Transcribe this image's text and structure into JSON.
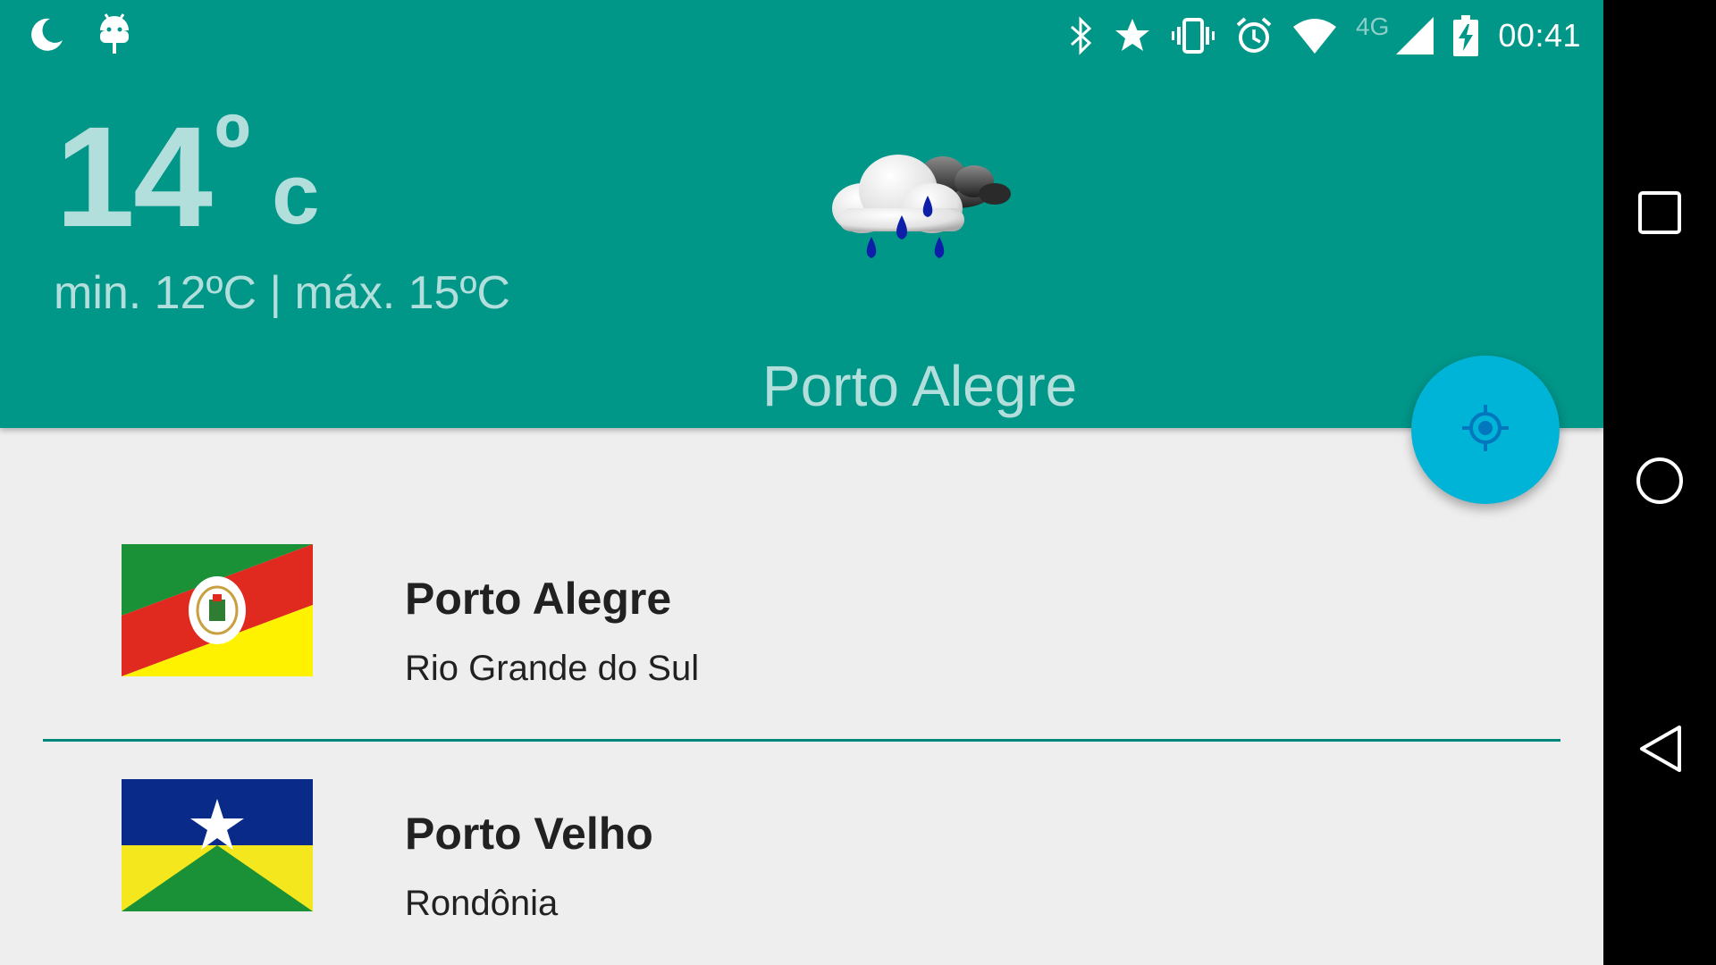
{
  "status_bar": {
    "left_icons": [
      "moon-icon",
      "android-debug-icon"
    ],
    "right_icons": [
      "bluetooth-icon",
      "star-icon",
      "vibrate-icon",
      "alarm-icon",
      "wifi-icon",
      "cell-signal-icon",
      "battery-charging-icon"
    ],
    "network_label": "4G",
    "time": "00:41"
  },
  "weather": {
    "temperature": "14",
    "degree_symbol": "º",
    "unit": "c",
    "minmax": "min. 12ºC | máx. 15ºC",
    "condition_icon": "rain-cloud-icon",
    "city": "Porto Alegre"
  },
  "fab": {
    "icon": "my-location-icon"
  },
  "cities": [
    {
      "name": "Porto Alegre",
      "state": "Rio Grande do Sul",
      "flag_icon": "rio-grande-do-sul-flag"
    },
    {
      "name": "Porto Velho",
      "state": "Rondônia",
      "flag_icon": "rondonia-flag"
    }
  ],
  "navigation": {
    "buttons": [
      "recent-apps-icon",
      "home-icon",
      "back-icon"
    ]
  },
  "colors": {
    "header": "#009688",
    "header_text": "#b2dfdb",
    "fab": "#00b4d8",
    "divider": "#00897b",
    "background": "#eeeeee"
  }
}
